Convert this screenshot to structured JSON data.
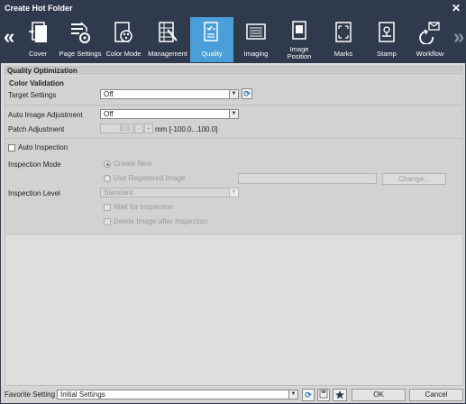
{
  "window": {
    "title": "Create Hot Folder",
    "close_glyph": "✕"
  },
  "toolbar": {
    "prev_glyph": "«",
    "next_glyph": "»",
    "tabs": [
      {
        "label": "Cover",
        "icon": "cover-icon"
      },
      {
        "label": "Page Settings",
        "icon": "page-settings-icon"
      },
      {
        "label": "Color Mode",
        "icon": "color-mode-icon"
      },
      {
        "label": "Management",
        "icon": "management-icon"
      },
      {
        "label": "Quality",
        "icon": "quality-icon",
        "active": true
      },
      {
        "label": "Imaging",
        "icon": "imaging-icon"
      },
      {
        "label": "Image\nPosition",
        "icon": "image-position-icon"
      },
      {
        "label": "Marks",
        "icon": "marks-icon"
      },
      {
        "label": "Stamp",
        "icon": "stamp-icon"
      },
      {
        "label": "Workflow",
        "icon": "workflow-icon"
      }
    ]
  },
  "section": {
    "title": "Quality Optimization",
    "subtitle": "Color Validation"
  },
  "target_settings": {
    "label": "Target Settings",
    "value": "Off"
  },
  "auto_image_adjustment": {
    "label": "Auto Image Adjustment",
    "value": "Off"
  },
  "patch_adjustment": {
    "label": "Patch Adjustment",
    "value": "0.0",
    "minus": "-",
    "plus": "+",
    "unit": "mm [-100.0...100.0]"
  },
  "auto_inspection": {
    "label": "Auto Inspection",
    "checked": false
  },
  "inspection_mode": {
    "label": "Inspection Mode",
    "option_create_new": "Create New",
    "option_registered": "Use Registered Image",
    "selected": "Create New",
    "change_button": "Change..."
  },
  "inspection_level": {
    "label": "Inspection Level",
    "value": "Standard"
  },
  "wait_for_inspection": {
    "label": "Wait for Inspection"
  },
  "delete_image": {
    "label": "Delete Image after Inspection"
  },
  "footer": {
    "favorite_label": "Favorite Setting",
    "favorite_value": "Initial Settings",
    "ok_label": "OK",
    "cancel_label": "Cancel"
  },
  "colors": {
    "titlebar": "#2f3a4d",
    "active_tab": "#4a9fd8",
    "refresh_icon": "#2a79c0"
  }
}
